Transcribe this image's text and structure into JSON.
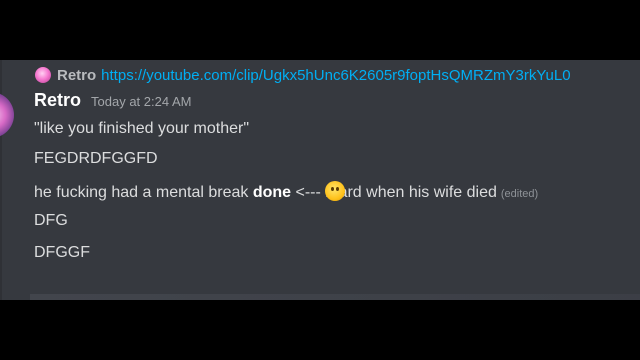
{
  "reply": {
    "author": "Retro",
    "link": "https://youtube.com/clip/Ugkx5hUnc6K2605r9foptHsQMRZmY3rkYuL0"
  },
  "message": {
    "author": "Retro",
    "timestamp": "Today at 2:24 AM",
    "lines": [
      {
        "text": "\"like you finished your mother\""
      },
      {
        "text": "FEGDRDFGGFD"
      },
      {
        "prefix": "he fucking had a mental break ",
        "bold": "done",
        "mid": " <--- r",
        "emoji": "flushed-face",
        "after": "ard when his wife died",
        "edited": "(edited)"
      },
      {
        "text": "DFG"
      },
      {
        "text": "DFGGF"
      }
    ]
  },
  "colors": {
    "background": "#36393f",
    "link": "#00aff4",
    "text": "#dcddde",
    "muted": "#a3a6aa"
  }
}
